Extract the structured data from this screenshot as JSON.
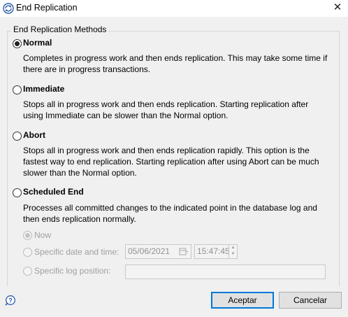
{
  "window": {
    "title": "End Replication",
    "close_glyph": "✕"
  },
  "group": {
    "title": "End Replication Methods"
  },
  "options": [
    {
      "label": "Normal",
      "selected": true,
      "description_lines": [
        "Completes in progress work and then ends replication. This may take some time if",
        "there are in progress transactions."
      ]
    },
    {
      "label": "Immediate",
      "selected": false,
      "description_lines": [
        "Stops all in progress work and then ends replication. Starting replication after",
        "using Immediate can be slower than the Normal option."
      ]
    },
    {
      "label": "Abort",
      "selected": false,
      "description_lines": [
        "Stops all in progress work and then ends replication rapidly. This option is the",
        "fastest way to end replication. Starting replication after using Abort can be much",
        "slower than the Normal option."
      ]
    },
    {
      "label": "Scheduled End",
      "selected": false,
      "description_lines": [
        "Processes all committed changes to the indicated point in the database log and",
        "then ends replication normally."
      ]
    }
  ],
  "scheduled": {
    "now_label": "Now",
    "specific_date_label": "Specific date and time:",
    "date_value": "05/06/2021",
    "time_value": "15:47:45",
    "log_position_label": "Specific log position:",
    "log_position_value": ""
  },
  "footer": {
    "ok_label": "Aceptar",
    "cancel_label": "Cancelar"
  },
  "icons": {
    "app": "replication-icon",
    "help": "help-icon",
    "calendar": "calendar-icon"
  }
}
